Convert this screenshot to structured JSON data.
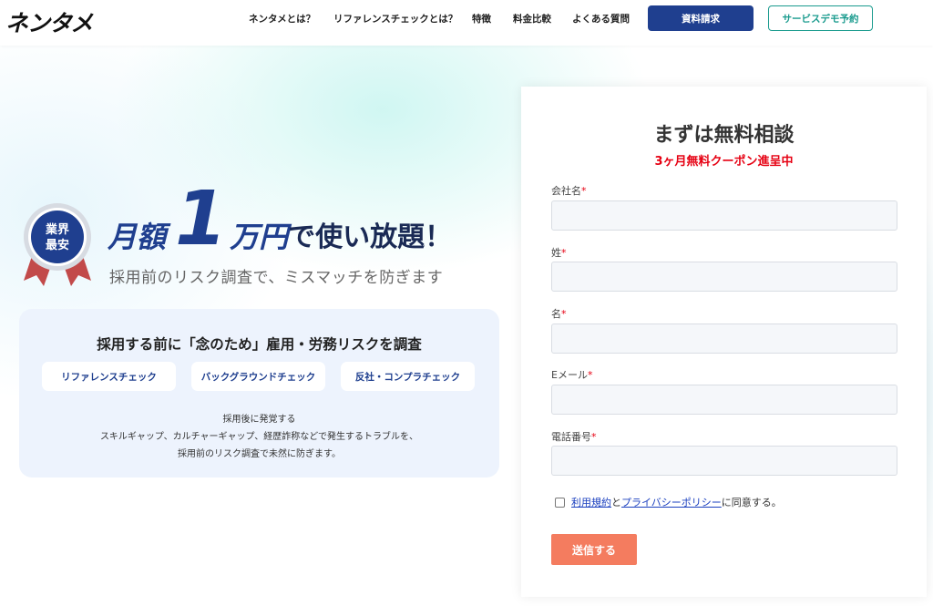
{
  "header": {
    "logo": "ネンタメ",
    "nav": [
      {
        "label": "ネンタメとは？"
      },
      {
        "label": "リファレンスチェックとは？"
      },
      {
        "label": "特徴"
      },
      {
        "label": "料金比較"
      },
      {
        "label": "よくある質問"
      }
    ],
    "docs_button": "資料請求",
    "demo_button": "サービスデモ予約"
  },
  "hero": {
    "badge_line1": "業界",
    "badge_line2": "最安",
    "headline_a": "月額",
    "headline_num": "1",
    "headline_b": "万円",
    "headline_c": "で使い放題！",
    "subhead": "採用前のリスク調査で、ミスマッチを防ぎます"
  },
  "risk": {
    "title": "採用する前に「念のため」雇用・労務リスクを調査",
    "pills": [
      {
        "label": "リファレンスチェック"
      },
      {
        "label": "バックグラウンドチェック"
      },
      {
        "label": "反社・コンプラチェック"
      }
    ],
    "desc_line1": "採用後に発覚する",
    "desc_line2": "スキルギャップ、カルチャーギャップ、経歴詐称などで発生するトラブルを、",
    "desc_line3": "採用前のリスク調査で未然に防ぎます。"
  },
  "form": {
    "title": "まずは無料相談",
    "subtitle": "3ヶ月無料クーポン進呈中",
    "fields": [
      {
        "label": "会社名",
        "required": "*"
      },
      {
        "label": "姓",
        "required": "*"
      },
      {
        "label": "名",
        "required": "*"
      },
      {
        "label": "Eメール",
        "required": "*"
      },
      {
        "label": "電話番号",
        "required": "*"
      }
    ],
    "agree_terms": "利用規約",
    "agree_and": "と",
    "agree_privacy": "プライバシーポリシー",
    "agree_suffix": "に同意する。",
    "submit": "送信する"
  },
  "colors": {
    "primary_navy": "#1f3f8f",
    "accent_teal": "#1a9b8e",
    "submit_orange": "#f47c5f",
    "required_red": "#e60012",
    "risk_box_bg": "#edf3fd"
  }
}
